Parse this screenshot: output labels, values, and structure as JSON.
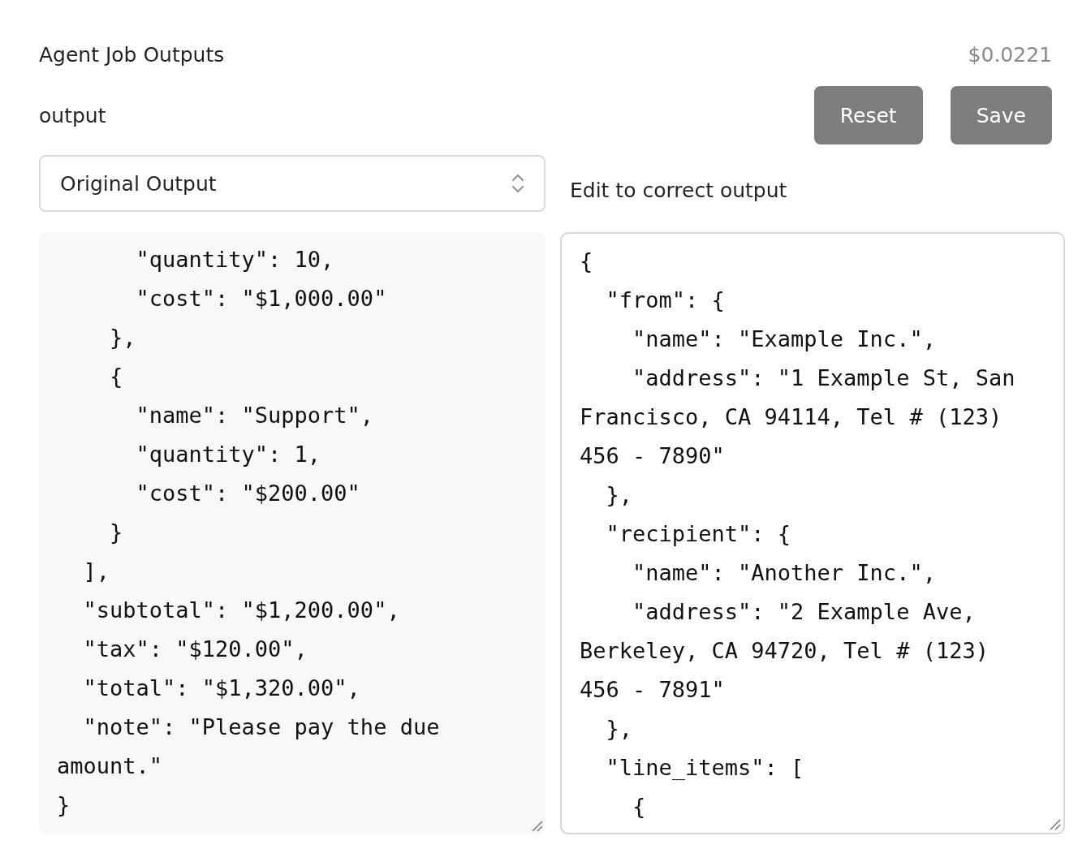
{
  "title": "Agent Job Outputs",
  "cost": "$0.0221",
  "output_label": "output",
  "buttons": [
    {
      "label": "Reset"
    },
    {
      "label": "Save"
    }
  ],
  "select": {
    "value": "Original Output"
  },
  "edit_label": "Edit to correct output",
  "original_output": {
    "lines": [
      "      \"quantity\": 10,",
      "      \"cost\": \"$1,000.00\"",
      "    },",
      "    {",
      "      \"name\": \"Support\",",
      "      \"quantity\": 1,",
      "      \"cost\": \"$200.00\"",
      "    }",
      "  ],",
      "  \"subtotal\": \"$1,200.00\",",
      "  \"tax\": \"$120.00\",",
      "  \"total\": \"$1,320.00\",",
      "  \"note\": \"Please pay the due",
      "amount.\"",
      "}"
    ]
  },
  "corrected_output": {
    "lines": [
      "{",
      "  \"from\": {",
      "    \"name\": \"Example Inc.\",",
      "    \"address\": \"1 Example St, San",
      "Francisco, CA 94114, Tel # (123)",
      "456 - 7890\"",
      "  },",
      "  \"recipient\": {",
      "    \"name\": \"Another Inc.\",",
      "    \"address\": \"2 Example Ave,",
      "Berkeley, CA 94720, Tel # (123)",
      "456 - 7891\"",
      "  },",
      "  \"line_items\": [",
      "    {"
    ]
  }
}
